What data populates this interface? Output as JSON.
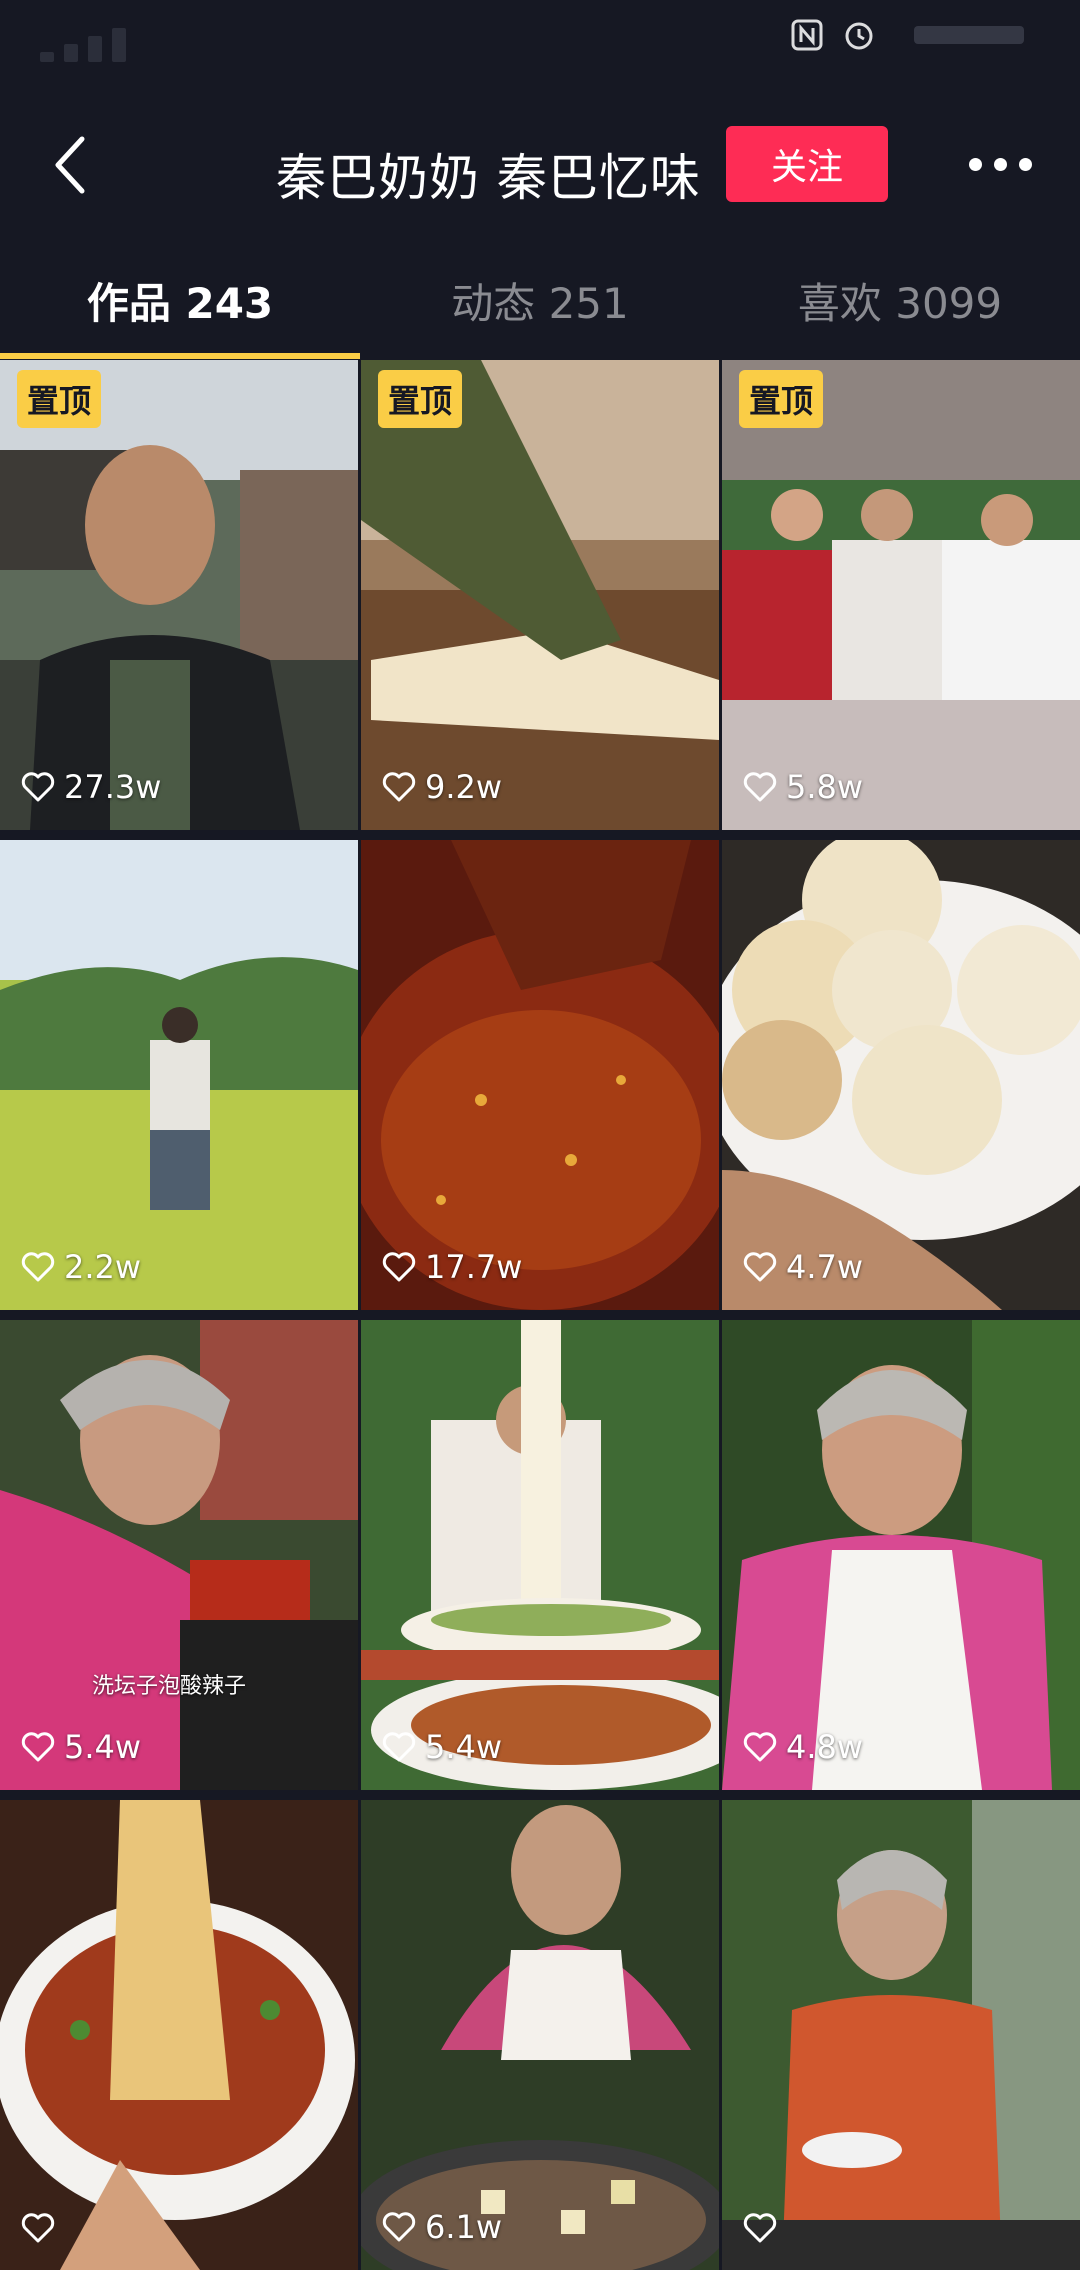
{
  "header": {
    "title": "秦巴奶奶 秦巴忆味",
    "follow_label": "关注"
  },
  "tabs": [
    {
      "label": "作品 243",
      "active": true
    },
    {
      "label": "动态 251",
      "active": false
    },
    {
      "label": "喜欢 3099",
      "active": false
    }
  ],
  "colors": {
    "background": "#161823",
    "accent_follow": "#fe2c55",
    "pin_badge": "#facd46",
    "tab_indicator": "#facd46"
  },
  "videos": [
    {
      "pinned_label": "置顶",
      "likes": "27.3w",
      "caption": ""
    },
    {
      "pinned_label": "置顶",
      "likes": "9.2w",
      "caption": ""
    },
    {
      "pinned_label": "置顶",
      "likes": "5.8w",
      "caption": ""
    },
    {
      "pinned_label": "",
      "likes": "2.2w",
      "caption": ""
    },
    {
      "pinned_label": "",
      "likes": "17.7w",
      "caption": ""
    },
    {
      "pinned_label": "",
      "likes": "4.7w",
      "caption": ""
    },
    {
      "pinned_label": "",
      "likes": "5.4w",
      "caption": "洗坛子泡酸辣子"
    },
    {
      "pinned_label": "",
      "likes": "5.4w",
      "caption": ""
    },
    {
      "pinned_label": "",
      "likes": "4.8w",
      "caption": ""
    },
    {
      "pinned_label": "",
      "likes": "",
      "caption": ""
    },
    {
      "pinned_label": "",
      "likes": "6.1w",
      "caption": ""
    },
    {
      "pinned_label": "",
      "likes": "",
      "caption": ""
    }
  ],
  "icons": {
    "back": "back-arrow-icon",
    "more": "more-dots-icon",
    "like": "heart-icon"
  }
}
